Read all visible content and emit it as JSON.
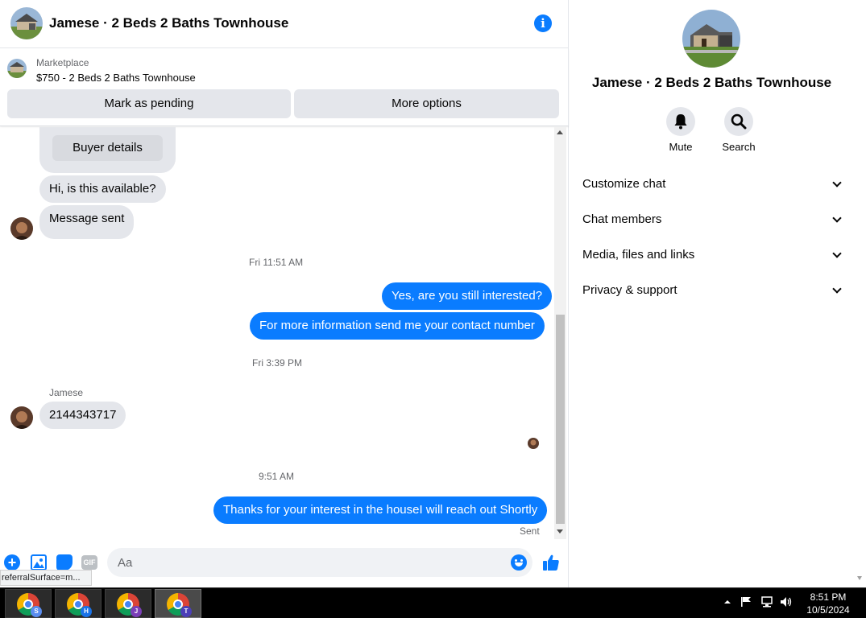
{
  "header": {
    "title": "Jamese · 2 Beds 2 Baths Townhouse",
    "info_icon": "info-icon"
  },
  "marketplace": {
    "label": "Marketplace",
    "listing": "$750 - 2 Beds 2 Baths Townhouse",
    "buttons": {
      "pending": "Mark as pending",
      "more": "More options"
    }
  },
  "messages": {
    "buyer_details": "Buyer details",
    "m1": "Hi, is this available?",
    "m2": "Message sent",
    "ts1": "Fri 11:51 AM",
    "m3": "Yes, are you still interested?",
    "m4": "For more information send me your contact number",
    "ts2": "Fri 3:39 PM",
    "sender": "Jamese",
    "m5": "2144343717",
    "ts3": "9:51 AM",
    "m6": "Thanks for your interest in the houseI will reach out Shortly",
    "status": "Sent"
  },
  "composer": {
    "placeholder": "Aa",
    "gif": "GIF"
  },
  "url_tooltip": "referralSurface=m...",
  "info_pane": {
    "title": "Jamese · 2 Beds 2 Baths Townhouse",
    "actions": {
      "mute": "Mute",
      "search": "Search"
    },
    "sections": [
      "Customize chat",
      "Chat members",
      "Media, files and links",
      "Privacy & support"
    ]
  },
  "taskbar": {
    "apps": [
      {
        "badge": "S",
        "badge_color": "#5b8def"
      },
      {
        "badge": "H",
        "badge_color": "#1a73e8"
      },
      {
        "badge": "J",
        "badge_color": "#7b3fb8"
      },
      {
        "badge": "T",
        "badge_color": "#4b3fb8"
      }
    ],
    "time": "8:51 PM",
    "date": "10/5/2024"
  },
  "colors": {
    "accent": "#0a7cff",
    "bubble_in": "#e4e6eb"
  }
}
